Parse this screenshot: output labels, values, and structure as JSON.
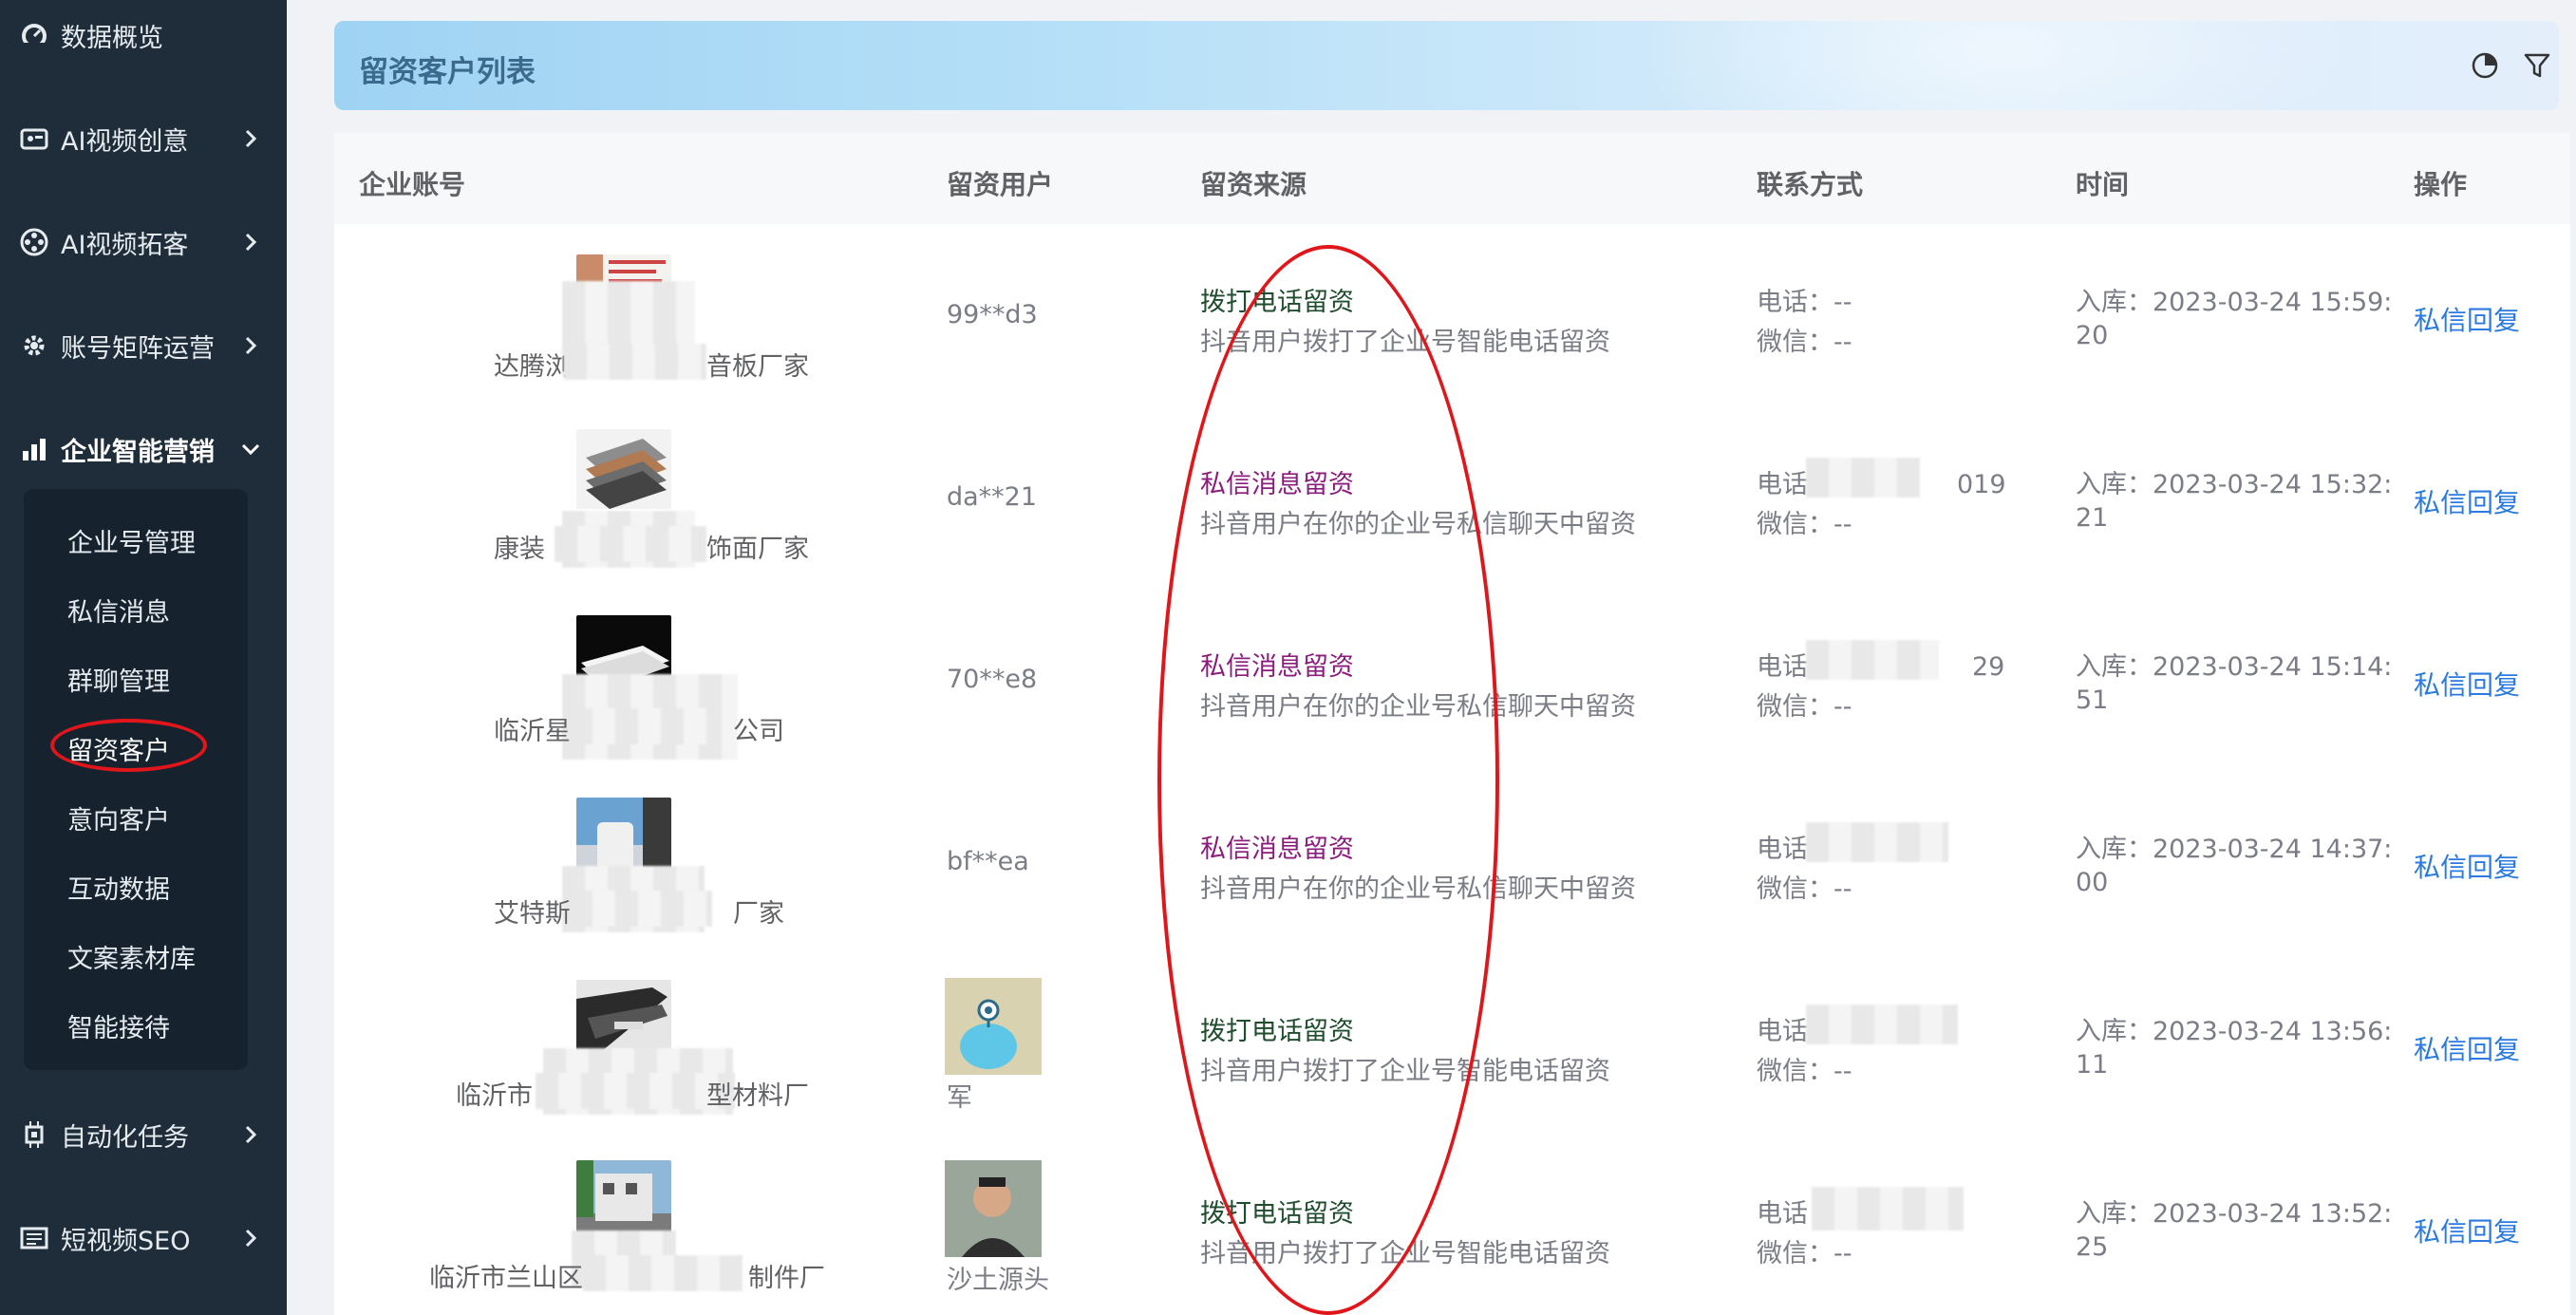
{
  "sidebar": {
    "items": [
      {
        "label": "数据概览",
        "icon": "dashboard-icon"
      },
      {
        "label": "AI视频创意",
        "icon": "video-creative-icon"
      },
      {
        "label": "AI视频拓客",
        "icon": "film-reel-icon"
      },
      {
        "label": "账号矩阵运营",
        "icon": "matrix-gear-icon"
      },
      {
        "label": "企业智能营销",
        "icon": "bar-chart-icon"
      },
      {
        "label": "自动化任务",
        "icon": "chip-icon"
      },
      {
        "label": "短视频SEO",
        "icon": "seo-panel-icon"
      }
    ],
    "submenu": [
      "企业号管理",
      "私信消息",
      "群聊管理",
      "留资客户",
      "意向客户",
      "互动数据",
      "文案素材库",
      "智能接待"
    ],
    "active_sub": "留资客户"
  },
  "header": {
    "title": "留资客户列表",
    "icons": [
      "pie-chart-icon",
      "filter-icon"
    ]
  },
  "table": {
    "columns": [
      "企业账号",
      "留资用户",
      "留资来源",
      "联系方式",
      "时间",
      "操作"
    ],
    "rows": [
      {
        "account": "达腾浏",
        "account_suffix": "音板厂家",
        "user": "99**d3",
        "source_title": "拨打电话留资",
        "source_type": "phone",
        "source_desc": "抖音用户拨打了企业号智能电话留资",
        "phone_label": "电话：",
        "phone": "--",
        "wechat_label": "微信：",
        "wechat": "--",
        "time_line1": "入库：2023-03-24 15:59:",
        "time_line2": "20",
        "op": "私信回复"
      },
      {
        "account": "康装",
        "account_suffix": "饰面厂家",
        "user": "da**21",
        "source_title": "私信消息留资",
        "source_type": "message",
        "source_desc": "抖音用户在你的企业号私信聊天中留资",
        "phone_label": "电话：",
        "phone": "019",
        "wechat_label": "微信：",
        "wechat": "--",
        "time_line1": "入库：2023-03-24 15:32:",
        "time_line2": "21",
        "op": "私信回复"
      },
      {
        "account": "临沂星",
        "account_suffix": "公司",
        "user": "70**e8",
        "source_title": "私信消息留资",
        "source_type": "message",
        "source_desc": "抖音用户在你的企业号私信聊天中留资",
        "phone_label": "电话：",
        "phone": "29",
        "wechat_label": "微信：",
        "wechat": "--",
        "time_line1": "入库：2023-03-24 15:14:",
        "time_line2": "51",
        "op": "私信回复"
      },
      {
        "account": "艾特斯",
        "account_suffix": "厂家",
        "user": "bf**ea",
        "source_title": "私信消息留资",
        "source_type": "message",
        "source_desc": "抖音用户在你的企业号私信聊天中留资",
        "phone_label": "电话：",
        "phone": "",
        "wechat_label": "微信：",
        "wechat": "--",
        "time_line1": "入库：2023-03-24 14:37:",
        "time_line2": "00",
        "op": "私信回复"
      },
      {
        "account": "临沂市",
        "account_suffix": "型材料厂",
        "user": "军",
        "source_title": "拨打电话留资",
        "source_type": "phone",
        "source_desc": "抖音用户拨打了企业号智能电话留资",
        "phone_label": "电话：",
        "phone": "",
        "wechat_label": "微信：",
        "wechat": "--",
        "time_line1": "入库：2023-03-24 13:56:",
        "time_line2": "11",
        "op": "私信回复"
      },
      {
        "account": "临沂市兰山区",
        "account_suffix": "制件厂",
        "user": "沙土源头",
        "source_title": "拨打电话留资",
        "source_type": "phone",
        "source_desc": "抖音用户拨打了企业号智能电话留资",
        "phone_label": "电话",
        "phone": "",
        "wechat_label": "微信：",
        "wechat": "--",
        "time_line1": "入库：2023-03-24 13:52:",
        "time_line2": "25",
        "op": "私信回复"
      }
    ]
  },
  "colors": {
    "phone_source": "#1f4d2e",
    "message_source": "#8a1c7c",
    "link": "#2a7ae2",
    "annotation": "#e0161b"
  }
}
